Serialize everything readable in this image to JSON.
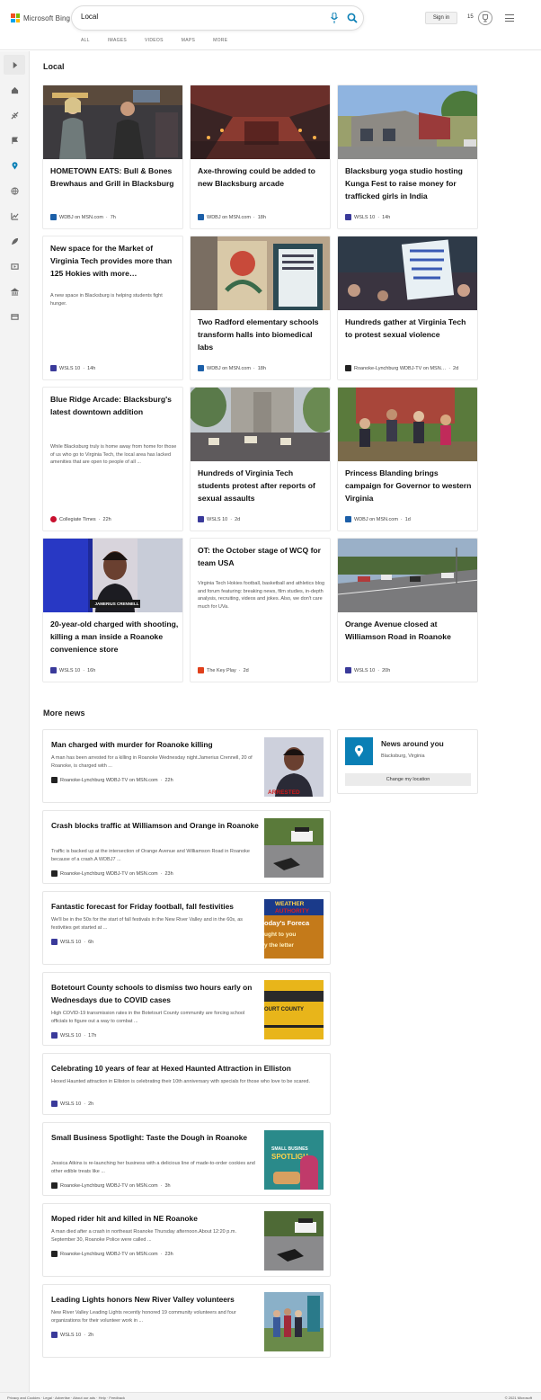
{
  "header": {
    "logo_text": "Microsoft Bing",
    "search_value": "Local",
    "tabs": [
      "ALL",
      "IMAGES",
      "VIDEOS",
      "MAPS",
      "MORE"
    ],
    "signin_label": "Sign in",
    "points": "15"
  },
  "rail": {
    "icons": [
      "chevron-right-icon",
      "home-icon",
      "satellite-icon",
      "flag-icon",
      "location-pin-icon",
      "globe-icon",
      "chart-icon",
      "rocket-icon",
      "video-icon",
      "bank-icon",
      "card-icon"
    ]
  },
  "local": {
    "heading": "Local",
    "cards": [
      {
        "title": "HOMETOWN EATS: Bull & Bones Brewhaus and Grill in Blacksburg",
        "source": "WDBJ on MSN.com",
        "time": "7h",
        "snippet": ""
      },
      {
        "title": "Axe-throwing could be added to new Blacksburg arcade",
        "source": "WDBJ on MSN.com",
        "time": "18h",
        "snippet": ""
      },
      {
        "title": "Blacksburg yoga studio hosting Kunga Fest to raise money for trafficked girls in India",
        "source": "WSLS 10",
        "time": "14h",
        "snippet": ""
      },
      {
        "title": "New space for the Market of Virginia Tech provides more than 125 Hokies with more…",
        "source": "WSLS 10",
        "time": "14h",
        "snippet": "A new space in Blacksburg is helping students fight hunger."
      },
      {
        "title": "Two Radford elementary schools transform halls into biomedical labs",
        "source": "WDBJ on MSN.com",
        "time": "18h",
        "snippet": ""
      },
      {
        "title": "Hundreds gather at Virginia Tech to protest sexual violence",
        "source": "Roanoke-Lynchburg WDBJ-TV on MSN…",
        "time": "2d",
        "snippet": ""
      },
      {
        "title": "Blue Ridge Arcade: Blacksburg's latest downtown addition",
        "source": "Collegiate Times",
        "time": "22h",
        "snippet": "While Blacksburg truly is home away from home for those of us who go to Virginia Tech, the local area has lacked amenities that are open to people of all ..."
      },
      {
        "title": "Hundreds of Virginia Tech students protest after reports of sexual assaults",
        "source": "WSLS 10",
        "time": "2d",
        "snippet": ""
      },
      {
        "title": "Princess Blanding brings campaign for Governor to western Virginia",
        "source": "WDBJ on MSN.com",
        "time": "1d",
        "snippet": ""
      },
      {
        "title": "20-year-old charged with shooting, killing a man inside a Roanoke convenience store",
        "source": "WSLS 10",
        "time": "16h",
        "snippet": ""
      },
      {
        "title": "OT: the October stage of WCQ for team USA",
        "source": "The Key Play",
        "time": "2d",
        "snippet": "Virginia Tech Hokies football, basketball and athletics blog and forum featuring: breaking news, film studies, in-depth analysis, recruiting, videos and jokes. Also, we don't care much for UVa."
      },
      {
        "title": "Orange Avenue closed at Williamson Road in Roanoke",
        "source": "WSLS 10",
        "time": "20h",
        "snippet": ""
      }
    ],
    "image_caption": "JAMERIUS CRENNELL"
  },
  "more_news": {
    "heading": "More news",
    "items": [
      {
        "title": "Man charged with murder for Roanoke killing",
        "snippet": "A man has been arrested for a killing in Roanoke Wednesday night.Jamerius Crennell, 20 of Roanoke, is charged with ...",
        "source": "Roanoke-Lynchburg WDBJ-TV on MSN.com",
        "time": "22h"
      },
      {
        "title": "Crash blocks traffic at Williamson and Orange in Roanoke",
        "snippet": "Traffic is backed up at the intersection of Orange Avenue and Williamson Road in Roanoke because of a crash.A WDBJ7 ...",
        "source": "Roanoke-Lynchburg WDBJ-TV on MSN.com",
        "time": "23h"
      },
      {
        "title": "Fantastic forecast for Friday football, fall festivities",
        "snippet": "We'll be in the 50s for the start of fall festivals in the New River Valley and in the 60s, as festivities get started at ...",
        "source": "WSLS 10",
        "time": "6h"
      },
      {
        "title": "Botetourt County schools to dismiss two hours early on Wednesdays due to COVID cases",
        "snippet": "High COVID-19 transmission rates in the Botetourt County community are forcing school officials to figure out a way to combat ...",
        "source": "WSLS 10",
        "time": "17h"
      },
      {
        "title": "Celebrating 10 years of fear at Hexed Haunted Attraction in Elliston",
        "snippet": "Hexed Haunted attraction in Elliston is celebrating their 10th anniversary with specials for those who love to be scared.",
        "source": "WSLS 10",
        "time": "2h"
      },
      {
        "title": "Small Business Spotlight: Taste the Dough in Roanoke",
        "snippet": "Jessica Atkins is re-launching her business with a delicious line of made-to-order cookies and other edible treats like ...",
        "source": "Roanoke-Lynchburg WDBJ-TV on MSN.com",
        "time": "3h"
      },
      {
        "title": "Moped rider hit and killed in NE Roanoke",
        "snippet": "A man died after a crash in northeast Roanoke Thursday afternoon.About 12:20 p.m. September 30, Roanoke Police were called ...",
        "source": "Roanoke-Lynchburg WDBJ-TV on MSN.com",
        "time": "23h"
      },
      {
        "title": "Leading Lights honors New River Valley volunteers",
        "snippet": "New River Valley Leading Lights recently honored 19 community volunteers and four organizations for their volunteer work in ...",
        "source": "WSLS 10",
        "time": "2h"
      }
    ],
    "thumb_texts": {
      "arrested": "ARRESTED",
      "weather": "WEATHER",
      "authority": "AUTHORITY",
      "forecast": "oday's Foreca",
      "brought": "ught to you",
      "letter": "y the letter",
      "county": "OURT COUNTY",
      "spotlight_1": "SMALL BUSINES",
      "spotlight_2": "SPOTLIGH"
    }
  },
  "news_around": {
    "title": "News around you",
    "location": "Blacksburg, Virginia",
    "button": "Change my location"
  },
  "footer": {
    "left": "Privacy and Cookies · Legal · Advertise · About our ads · Help · Feedback",
    "right": "© 2021 Microsoft"
  },
  "colors": {
    "accent": "#0a7fb5",
    "wdbj": "#1c5fa8",
    "wsls": "#3a3a9a",
    "collegiate": "#c8102e",
    "keyplay": "#e0401b"
  }
}
